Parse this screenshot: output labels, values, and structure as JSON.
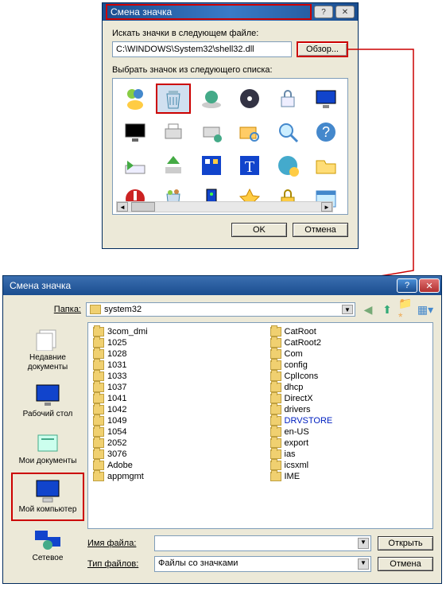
{
  "dialog1": {
    "title": "Смена значка",
    "search_label": "Искать значки в следующем файле:",
    "file_value": "C:\\WINDOWS\\System32\\shell32.dll",
    "browse_button": "Обзор...",
    "list_label": "Выбрать значок из следующего списка:",
    "ok_button": "OK",
    "cancel_button": "Отмена",
    "help_glyph": "?",
    "close_glyph": "✕",
    "icons": [
      "msn-icon",
      "recycle-bin-icon",
      "world-disc-icon",
      "disc-icon",
      "security-icon",
      "monitor-icon",
      "monitor2-icon",
      "printer-icon",
      "printer-net-icon",
      "folder-search-icon",
      "magnify-icon",
      "help-icon",
      "run-icon",
      "eject-icon",
      "control-panel-icon",
      "font-icon",
      "globe-settings-icon",
      "folder-open-icon",
      "shutdown-icon",
      "bin-full-icon",
      "server-icon",
      "favorite-icon",
      "lock-icon",
      "window-icon"
    ],
    "selected_icon": 1
  },
  "dialog2": {
    "title": "Смена значка",
    "folder_label": "Папка:",
    "current_folder": "system32",
    "toolbar": {
      "back": "back-icon",
      "up": "up-icon",
      "newfolder": "new-folder-icon",
      "views": "views-icon"
    },
    "places": [
      {
        "label": "Недавние документы",
        "icon": "recent-docs-icon"
      },
      {
        "label": "Рабочий стол",
        "icon": "desktop-icon"
      },
      {
        "label": "Мои документы",
        "icon": "my-documents-icon"
      },
      {
        "label": "Мой компьютер",
        "icon": "my-computer-icon",
        "selected": true
      },
      {
        "label": "Сетевое",
        "icon": "network-icon"
      }
    ],
    "files_col1": [
      "3com_dmi",
      "1025",
      "1028",
      "1031",
      "1033",
      "1037",
      "1041",
      "1042",
      "1049",
      "1054",
      "2052",
      "3076",
      "Adobe",
      "appmgmt"
    ],
    "files_col2": [
      "CatRoot",
      "CatRoot2",
      "Com",
      "config",
      "CplIcons",
      "dhcp",
      "DirectX",
      "drivers",
      "DRVSTORE",
      "en-US",
      "export",
      "ias",
      "icsxml",
      "IME"
    ],
    "drvstore_special": "DRVSTORE",
    "filename_label": "Имя файла:",
    "filename_value": "",
    "filetype_label": "Тип файлов:",
    "filetype_value": "Файлы со значками",
    "open_button": "Открыть",
    "cancel_button": "Отмена",
    "help_glyph": "?",
    "close_glyph": "✕"
  }
}
